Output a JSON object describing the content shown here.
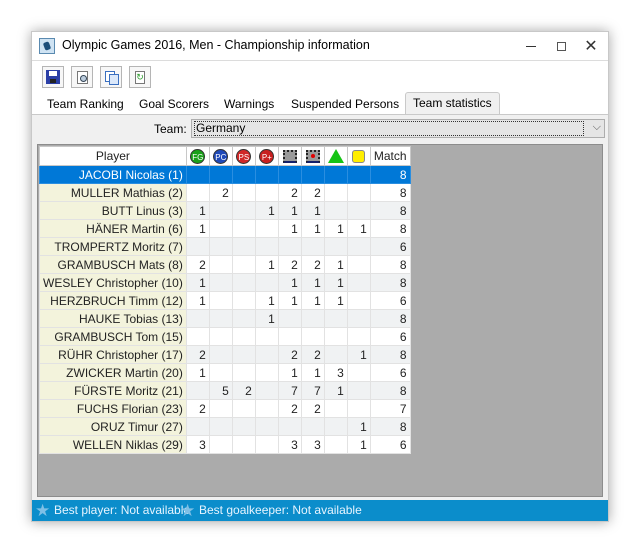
{
  "window": {
    "title": "Olympic Games 2016, Men - Championship information",
    "app_icon": "hockey-player-icon",
    "controls": {
      "minimize": "minimize-icon",
      "maximize": "maximize-icon",
      "close": "close-icon"
    }
  },
  "toolbar": {
    "buttons": [
      {
        "name": "save",
        "icon": "save-icon"
      },
      {
        "name": "print-preview",
        "icon": "print-preview-icon"
      },
      {
        "name": "copy",
        "icon": "copy-icon"
      },
      {
        "name": "refresh",
        "icon": "refresh-icon"
      }
    ]
  },
  "tabs": [
    {
      "label": "Team Ranking",
      "active": false
    },
    {
      "label": "Goal Scorers",
      "active": false
    },
    {
      "label": "Warnings",
      "active": false
    },
    {
      "label": "Suspended Persons",
      "active": false
    },
    {
      "label": "Team statistics",
      "active": true
    }
  ],
  "team_filter": {
    "label": "Team:",
    "value": "Germany"
  },
  "grid": {
    "columns": [
      {
        "key": "player",
        "label": "Player"
      },
      {
        "key": "fg",
        "label": "FG",
        "icon": "field-goal-icon",
        "color": "#1aa01a"
      },
      {
        "key": "pc",
        "label": "PC",
        "icon": "penalty-corner-icon",
        "color": "#1f49b8"
      },
      {
        "key": "ps",
        "label": "PS",
        "icon": "penalty-stroke-icon",
        "color": "#d02828"
      },
      {
        "key": "pp",
        "label": "P+",
        "icon": "penalty-plus-icon",
        "color": "#c82020"
      },
      {
        "key": "sq1",
        "label": "",
        "icon": "checkered-square-icon"
      },
      {
        "key": "sq2",
        "label": "",
        "icon": "checkered-square-red-dot-icon"
      },
      {
        "key": "green",
        "label": "",
        "icon": "green-card-icon",
        "color": "#16c416"
      },
      {
        "key": "yellow",
        "label": "",
        "icon": "yellow-card-icon",
        "color": "#ffee00"
      },
      {
        "key": "match",
        "label": "Match"
      }
    ],
    "selected_row": 0,
    "rows": [
      {
        "player": "JACOBI Nicolas (1)",
        "fg": "",
        "pc": "",
        "ps": "",
        "pp": "",
        "sq1": "",
        "sq2": "",
        "green": "",
        "yellow": "",
        "match": "8"
      },
      {
        "player": "MULLER Mathias (2)",
        "fg": "",
        "pc": "2",
        "ps": "",
        "pp": "",
        "sq1": "2",
        "sq2": "2",
        "green": "",
        "yellow": "",
        "match": "8"
      },
      {
        "player": "BUTT Linus (3)",
        "fg": "1",
        "pc": "",
        "ps": "",
        "pp": "1",
        "sq1": "1",
        "sq2": "1",
        "green": "",
        "yellow": "",
        "match": "8"
      },
      {
        "player": "HÄNER Martin (6)",
        "fg": "1",
        "pc": "",
        "ps": "",
        "pp": "",
        "sq1": "1",
        "sq2": "1",
        "green": "1",
        "yellow": "1",
        "match": "8"
      },
      {
        "player": "TROMPERTZ Moritz (7)",
        "fg": "",
        "pc": "",
        "ps": "",
        "pp": "",
        "sq1": "",
        "sq2": "",
        "green": "",
        "yellow": "",
        "match": "6"
      },
      {
        "player": "GRAMBUSCH Mats (8)",
        "fg": "2",
        "pc": "",
        "ps": "",
        "pp": "1",
        "sq1": "2",
        "sq2": "2",
        "green": "1",
        "yellow": "",
        "match": "8"
      },
      {
        "player": "WESLEY Christopher (10)",
        "fg": "1",
        "pc": "",
        "ps": "",
        "pp": "",
        "sq1": "1",
        "sq2": "1",
        "green": "1",
        "yellow": "",
        "match": "8"
      },
      {
        "player": "HERZBRUCH Timm (12)",
        "fg": "1",
        "pc": "",
        "ps": "",
        "pp": "1",
        "sq1": "1",
        "sq2": "1",
        "green": "1",
        "yellow": "",
        "match": "6"
      },
      {
        "player": "HAUKE Tobias (13)",
        "fg": "",
        "pc": "",
        "ps": "",
        "pp": "1",
        "sq1": "",
        "sq2": "",
        "green": "",
        "yellow": "",
        "match": "8"
      },
      {
        "player": "GRAMBUSCH Tom (15)",
        "fg": "",
        "pc": "",
        "ps": "",
        "pp": "",
        "sq1": "",
        "sq2": "",
        "green": "",
        "yellow": "",
        "match": "6"
      },
      {
        "player": "RÜHR Christopher (17)",
        "fg": "2",
        "pc": "",
        "ps": "",
        "pp": "",
        "sq1": "2",
        "sq2": "2",
        "green": "",
        "yellow": "1",
        "match": "8"
      },
      {
        "player": "ZWICKER Martin (20)",
        "fg": "1",
        "pc": "",
        "ps": "",
        "pp": "",
        "sq1": "1",
        "sq2": "1",
        "green": "3",
        "yellow": "",
        "match": "6"
      },
      {
        "player": "FÜRSTE Moritz (21)",
        "fg": "",
        "pc": "5",
        "ps": "2",
        "pp": "",
        "sq1": "7",
        "sq2": "7",
        "green": "1",
        "yellow": "",
        "match": "8"
      },
      {
        "player": "FUCHS Florian (23)",
        "fg": "2",
        "pc": "",
        "ps": "",
        "pp": "",
        "sq1": "2",
        "sq2": "2",
        "green": "",
        "yellow": "",
        "match": "7"
      },
      {
        "player": "ORUZ Timur (27)",
        "fg": "",
        "pc": "",
        "ps": "",
        "pp": "",
        "sq1": "",
        "sq2": "",
        "green": "",
        "yellow": "1",
        "match": "8"
      },
      {
        "player": "WELLEN Niklas (29)",
        "fg": "3",
        "pc": "",
        "ps": "",
        "pp": "",
        "sq1": "3",
        "sq2": "3",
        "green": "",
        "yellow": "1",
        "match": "6"
      }
    ]
  },
  "statusbar": {
    "best_player": "Best player: Not available",
    "best_goalkeeper": "Best goalkeeper: Not available",
    "icon": "star-icon"
  }
}
